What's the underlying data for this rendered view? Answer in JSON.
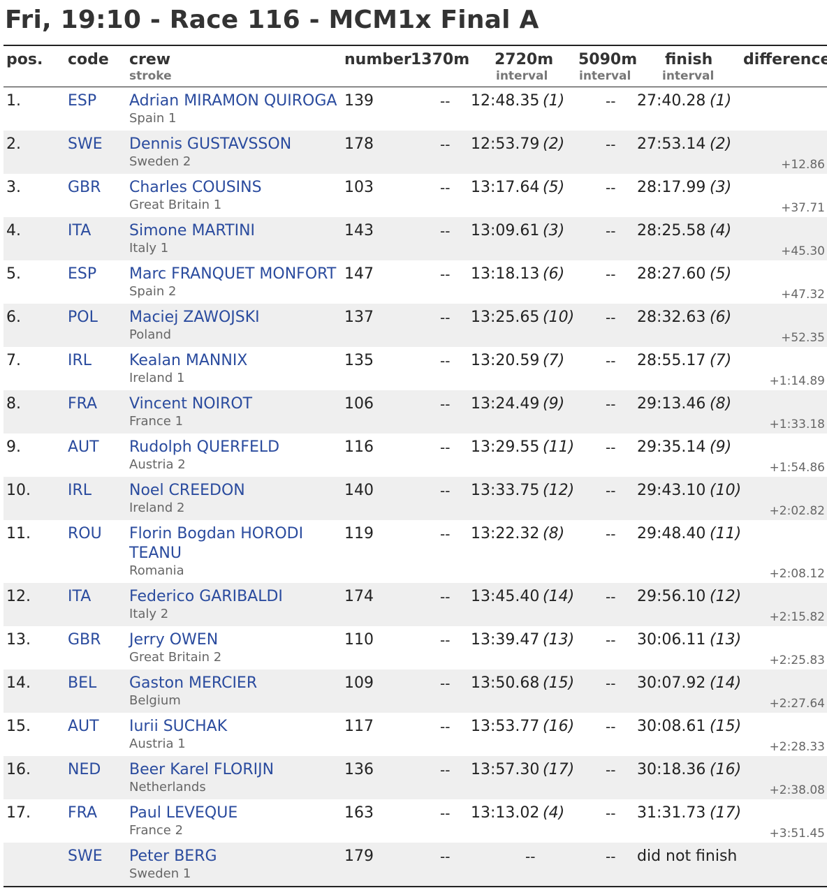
{
  "title": "Fri, 19:10 - Race 116 - MCM1x Final A",
  "headers": {
    "pos": "pos.",
    "code": "code",
    "crew": "crew",
    "crew_sub": "stroke",
    "number": "number",
    "split1": "1370m",
    "split2": "2720m",
    "split2_sub": "interval",
    "split3": "5090m",
    "split3_sub": "interval",
    "finish": "finish",
    "finish_sub": "interval",
    "difference": "difference"
  },
  "rows": [
    {
      "pos": "1.",
      "code": "ESP",
      "name": "Adrian MIRAMON QUIROGA",
      "crew": "Spain 1",
      "number": "139",
      "s1": "--",
      "s2": "12:48.35",
      "s2r": "(1)",
      "s3": "--",
      "fin": "27:40.28",
      "finr": "(1)",
      "diff": ""
    },
    {
      "pos": "2.",
      "code": "SWE",
      "name": "Dennis GUSTAVSSON",
      "crew": "Sweden 2",
      "number": "178",
      "s1": "--",
      "s2": "12:53.79",
      "s2r": "(2)",
      "s3": "--",
      "fin": "27:53.14",
      "finr": "(2)",
      "diff": "+12.86"
    },
    {
      "pos": "3.",
      "code": "GBR",
      "name": "Charles COUSINS",
      "crew": "Great Britain 1",
      "number": "103",
      "s1": "--",
      "s2": "13:17.64",
      "s2r": "(5)",
      "s3": "--",
      "fin": "28:17.99",
      "finr": "(3)",
      "diff": "+37.71"
    },
    {
      "pos": "4.",
      "code": "ITA",
      "name": "Simone MARTINI",
      "crew": "Italy 1",
      "number": "143",
      "s1": "--",
      "s2": "13:09.61",
      "s2r": "(3)",
      "s3": "--",
      "fin": "28:25.58",
      "finr": "(4)",
      "diff": "+45.30"
    },
    {
      "pos": "5.",
      "code": "ESP",
      "name": "Marc FRANQUET MONFORT",
      "crew": "Spain 2",
      "number": "147",
      "s1": "--",
      "s2": "13:18.13",
      "s2r": "(6)",
      "s3": "--",
      "fin": "28:27.60",
      "finr": "(5)",
      "diff": "+47.32"
    },
    {
      "pos": "6.",
      "code": "POL",
      "name": "Maciej ZAWOJSKI",
      "crew": "Poland",
      "number": "137",
      "s1": "--",
      "s2": "13:25.65",
      "s2r": "(10)",
      "s3": "--",
      "fin": "28:32.63",
      "finr": "(6)",
      "diff": "+52.35"
    },
    {
      "pos": "7.",
      "code": "IRL",
      "name": "Kealan MANNIX",
      "crew": "Ireland 1",
      "number": "135",
      "s1": "--",
      "s2": "13:20.59",
      "s2r": "(7)",
      "s3": "--",
      "fin": "28:55.17",
      "finr": "(7)",
      "diff": "+1:14.89"
    },
    {
      "pos": "8.",
      "code": "FRA",
      "name": "Vincent NOIROT",
      "crew": "France 1",
      "number": "106",
      "s1": "--",
      "s2": "13:24.49",
      "s2r": "(9)",
      "s3": "--",
      "fin": "29:13.46",
      "finr": "(8)",
      "diff": "+1:33.18"
    },
    {
      "pos": "9.",
      "code": "AUT",
      "name": "Rudolph QUERFELD",
      "crew": "Austria 2",
      "number": "116",
      "s1": "--",
      "s2": "13:29.55",
      "s2r": "(11)",
      "s3": "--",
      "fin": "29:35.14",
      "finr": "(9)",
      "diff": "+1:54.86"
    },
    {
      "pos": "10.",
      "code": "IRL",
      "name": "Noel CREEDON",
      "crew": "Ireland 2",
      "number": "140",
      "s1": "--",
      "s2": "13:33.75",
      "s2r": "(12)",
      "s3": "--",
      "fin": "29:43.10",
      "finr": "(10)",
      "diff": "+2:02.82"
    },
    {
      "pos": "11.",
      "code": "ROU",
      "name": "Florin Bogdan HORODI TEANU",
      "crew": "Romania",
      "number": "119",
      "s1": "--",
      "s2": "13:22.32",
      "s2r": "(8)",
      "s3": "--",
      "fin": "29:48.40",
      "finr": "(11)",
      "diff": "+2:08.12"
    },
    {
      "pos": "12.",
      "code": "ITA",
      "name": "Federico GARIBALDI",
      "crew": "Italy 2",
      "number": "174",
      "s1": "--",
      "s2": "13:45.40",
      "s2r": "(14)",
      "s3": "--",
      "fin": "29:56.10",
      "finr": "(12)",
      "diff": "+2:15.82"
    },
    {
      "pos": "13.",
      "code": "GBR",
      "name": "Jerry OWEN",
      "crew": "Great Britain 2",
      "number": "110",
      "s1": "--",
      "s2": "13:39.47",
      "s2r": "(13)",
      "s3": "--",
      "fin": "30:06.11",
      "finr": "(13)",
      "diff": "+2:25.83"
    },
    {
      "pos": "14.",
      "code": "BEL",
      "name": "Gaston MERCIER",
      "crew": "Belgium",
      "number": "109",
      "s1": "--",
      "s2": "13:50.68",
      "s2r": "(15)",
      "s3": "--",
      "fin": "30:07.92",
      "finr": "(14)",
      "diff": "+2:27.64"
    },
    {
      "pos": "15.",
      "code": "AUT",
      "name": "Iurii SUCHAK",
      "crew": "Austria 1",
      "number": "117",
      "s1": "--",
      "s2": "13:53.77",
      "s2r": "(16)",
      "s3": "--",
      "fin": "30:08.61",
      "finr": "(15)",
      "diff": "+2:28.33"
    },
    {
      "pos": "16.",
      "code": "NED",
      "name": "Beer Karel FLORIJN",
      "crew": "Netherlands",
      "number": "136",
      "s1": "--",
      "s2": "13:57.30",
      "s2r": "(17)",
      "s3": "--",
      "fin": "30:18.36",
      "finr": "(16)",
      "diff": "+2:38.08"
    },
    {
      "pos": "17.",
      "code": "FRA",
      "name": "Paul LEVEQUE",
      "crew": "France 2",
      "number": "163",
      "s1": "--",
      "s2": "13:13.02",
      "s2r": "(4)",
      "s3": "--",
      "fin": "31:31.73",
      "finr": "(17)",
      "diff": "+3:51.45"
    },
    {
      "pos": "",
      "code": "SWE",
      "name": "Peter BERG",
      "crew": "Sweden 1",
      "number": "179",
      "s1": "--",
      "s2": "--",
      "s2r": "",
      "s3": "--",
      "fin": "did not finish",
      "finr": "",
      "diff": ""
    }
  ],
  "colors": {
    "link": "#2a4b9e",
    "alt_row": "#efefef",
    "muted": "#666666"
  }
}
